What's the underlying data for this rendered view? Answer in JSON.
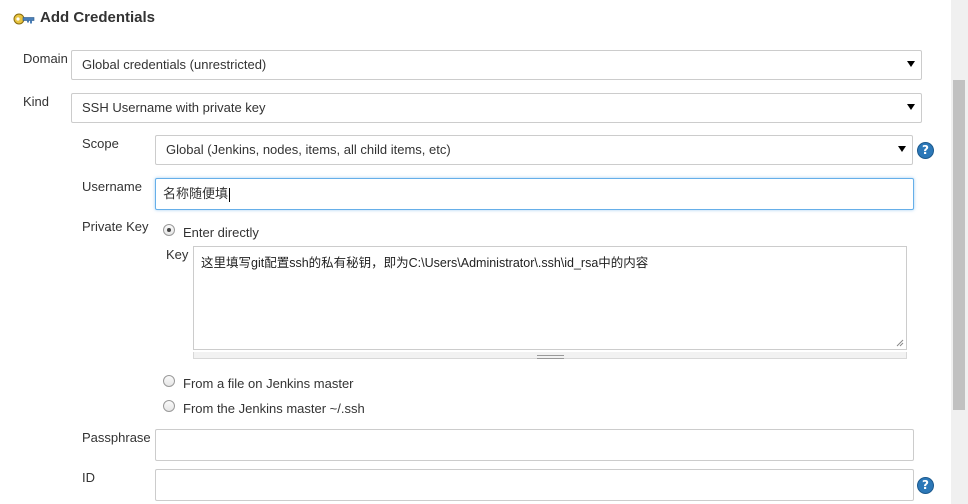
{
  "page": {
    "title": "Add Credentials"
  },
  "domain": {
    "label": "Domain",
    "value": "Global credentials (unrestricted)"
  },
  "kind": {
    "label": "Kind",
    "value": "SSH Username with private key"
  },
  "scope": {
    "label": "Scope",
    "value": "Global (Jenkins, nodes, items, all child items, etc)"
  },
  "username": {
    "label": "Username",
    "value": "名称随便填"
  },
  "private_key": {
    "label": "Private Key",
    "options": [
      {
        "label": "Enter directly",
        "checked": true
      },
      {
        "label": "From a file on Jenkins master",
        "checked": false
      },
      {
        "label": "From the Jenkins master ~/.ssh",
        "checked": false
      }
    ],
    "key_label": "Key",
    "key_value": "这里填写git配置ssh的私有秘钥，即为C:\\Users\\Administrator\\.ssh\\id_rsa中的内容"
  },
  "passphrase": {
    "label": "Passphrase",
    "value": ""
  },
  "id_field": {
    "label": "ID",
    "value": ""
  },
  "icons": {
    "title_icon": "key-icon",
    "help_icon": "help-icon"
  },
  "colors": {
    "help_icon": "#2c78b8",
    "focus_border": "#66afe9"
  }
}
